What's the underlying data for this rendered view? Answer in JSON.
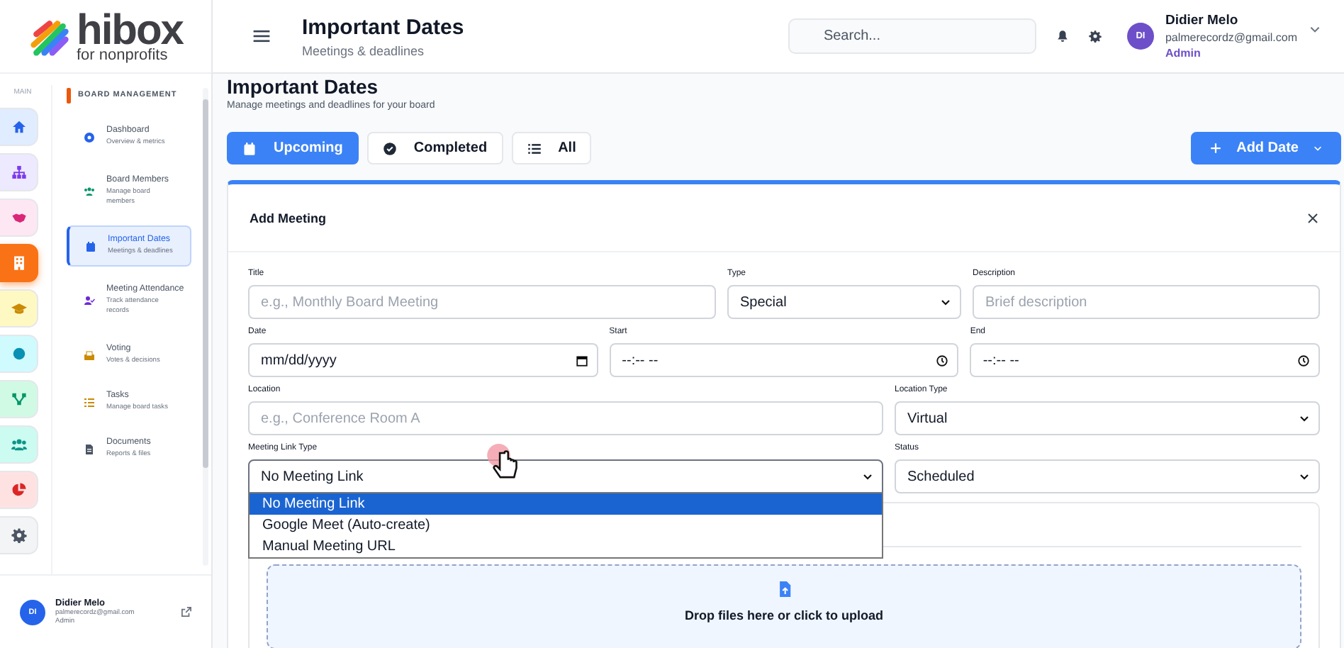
{
  "logo": {
    "name": "hibox",
    "tagline": "for nonprofits"
  },
  "rail": {
    "label": "MAIN",
    "items": [
      {
        "color": "#2563eb",
        "selected": false
      },
      {
        "color": "#7c3aed",
        "selected": false
      },
      {
        "color": "#db2777",
        "selected": false
      },
      {
        "color": "#ffffff",
        "selected": true
      },
      {
        "color": "#ca8a04",
        "selected": false
      },
      {
        "color": "#0891b2",
        "selected": false
      },
      {
        "color": "#059669",
        "selected": false
      },
      {
        "color": "#0d9488",
        "selected": false
      },
      {
        "color": "#dc2626",
        "selected": false
      },
      {
        "color": "#4b5563",
        "selected": false
      }
    ]
  },
  "nav": {
    "title": "BOARD MANAGEMENT",
    "items": [
      {
        "title": "Dashboard",
        "subtitle": "Overview & metrics",
        "color": "#2563eb",
        "selected": false
      },
      {
        "title": "Board Members",
        "subtitle": "Manage board members",
        "color": "#059669",
        "selected": false
      },
      {
        "title": "Important Dates",
        "subtitle": "Meetings & deadlines",
        "color": "#2563eb",
        "selected": true
      },
      {
        "title": "Meeting Attendance",
        "subtitle": "Track attendance records",
        "color": "#6d28d9",
        "selected": false
      },
      {
        "title": "Voting",
        "subtitle": "Votes & decisions",
        "color": "#ca8a04",
        "selected": false
      },
      {
        "title": "Tasks",
        "subtitle": "Manage board tasks",
        "color": "#ca8a04",
        "selected": false
      },
      {
        "title": "Documents",
        "subtitle": "Reports & files",
        "color": "#4b5563",
        "selected": false
      }
    ]
  },
  "sidebar_user": {
    "initials": "DI",
    "name": "Didier Melo",
    "email": "palmerecordz@gmail.com",
    "role": "Admin"
  },
  "topbar": {
    "title": "Important Dates",
    "subtitle": "Meetings & deadlines",
    "search": {
      "placeholder": "Search..."
    },
    "user": {
      "initials": "DI",
      "name": "Didier Melo",
      "email": "palmerecordz@gmail.com",
      "role": "Admin"
    }
  },
  "page": {
    "title": "Important Dates",
    "subtitle": "Manage meetings and deadlines for your board",
    "filters": [
      {
        "label": "Upcoming",
        "selected": true
      },
      {
        "label": "Completed",
        "selected": false
      },
      {
        "label": "All",
        "selected": false
      }
    ],
    "add_button": "Add Date"
  },
  "form": {
    "title": "Add Meeting",
    "rows": [
      [
        {
          "label": "Title",
          "kind": "text",
          "placeholder": "e.g., Monthly Board Meeting"
        },
        {
          "label": "Type",
          "kind": "select",
          "value": "Special"
        },
        {
          "label": "Description",
          "kind": "text",
          "placeholder": "Brief description"
        }
      ],
      [
        {
          "label": "Date",
          "kind": "date",
          "value": "mm/dd/yyyy"
        },
        {
          "label": "Start",
          "kind": "time",
          "value": "--:-- --"
        },
        {
          "label": "End",
          "kind": "time",
          "value": "--:-- --"
        }
      ],
      [
        {
          "label": "Location",
          "kind": "text",
          "placeholder": "e.g., Conference Room A"
        },
        {
          "label": "Location Type",
          "kind": "select",
          "value": "Virtual"
        }
      ],
      [
        {
          "label": "Meeting Link Type",
          "kind": "select",
          "value": "No Meeting Link",
          "open": true
        },
        {
          "label": "Status",
          "kind": "select",
          "value": "Scheduled"
        }
      ]
    ],
    "dropdown": [
      {
        "label": "No Meeting Link",
        "selected": true
      },
      {
        "label": "Google Meet (Auto-create)",
        "selected": false
      },
      {
        "label": "Manual Meeting URL",
        "selected": false
      }
    ],
    "upload": "Drop files here or click to upload"
  }
}
